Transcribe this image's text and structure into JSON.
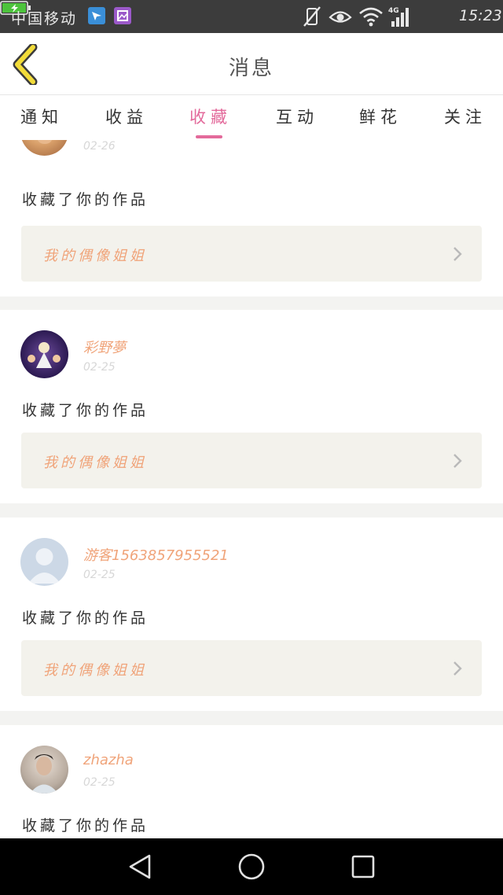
{
  "status_bar": {
    "carrier": "中国移动",
    "network": "4G",
    "time": "15:23"
  },
  "header": {
    "title": "消息",
    "back_icon": "chevron-left-icon"
  },
  "tabs": [
    {
      "label": "通知",
      "active": false
    },
    {
      "label": "收益",
      "active": false
    },
    {
      "label": "收藏",
      "active": true
    },
    {
      "label": "互动",
      "active": false
    },
    {
      "label": "鲜花",
      "active": false
    },
    {
      "label": "关注",
      "active": false
    }
  ],
  "feed": [
    {
      "username": "",
      "date": "02-26",
      "action": "收藏了你的作品",
      "work_title": "我的偶像姐姐"
    },
    {
      "username": "彩野夢",
      "date": "02-25",
      "action": "收藏了你的作品",
      "work_title": "我的偶像姐姐"
    },
    {
      "username": "游客15638579555​21",
      "date": "02-25",
      "action": "收藏了你的作品",
      "work_title": "我的偶像姐姐"
    },
    {
      "username": "zhazha",
      "date": "02-25",
      "action": "收藏了你的作品",
      "work_title": ""
    }
  ],
  "colors": {
    "accent": "#e36a9b",
    "username": "#f0a47a",
    "card_bg": "#f3f2ec",
    "back_icon": "#f2dc3a"
  }
}
